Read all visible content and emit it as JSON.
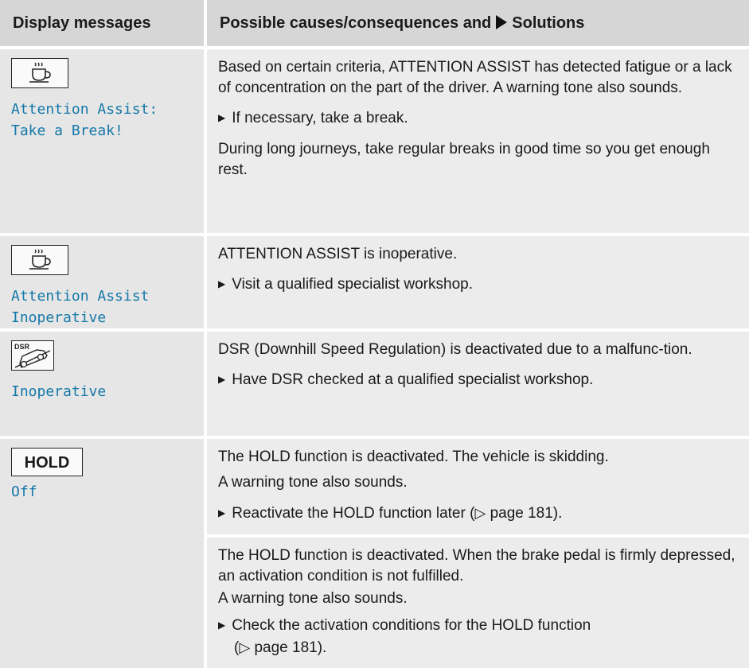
{
  "table": {
    "header_col1": "Display messages",
    "header_col2_pre": "Possible causes/consequences and",
    "header_col2_post": "Solutions"
  },
  "rows": [
    {
      "icon": "coffee-cup-icon",
      "message": "Attention Assist:\nTake a Break!",
      "text1": "Based on certain criteria, ATTENTION ASSIST has detected fatigue or a lack of concentration on the part of the driver. A warning tone also sounds.",
      "step1": "If necessary, take a break.",
      "text2": "During long journeys, take regular breaks in good time so you get enough rest."
    },
    {
      "icon": "coffee-cup-icon",
      "message": "Attention Assist\nInoperative",
      "text1": "ATTENTION ASSIST is inoperative.",
      "step1": "Visit a qualified specialist workshop."
    },
    {
      "icon": "dsr-icon",
      "icon_label": "DSR",
      "message": "Inoperative",
      "text1": "DSR (Downhill Speed Regulation) is deactivated due to a malfunc-tion.",
      "step1": "Have DSR checked at a qualified specialist workshop."
    },
    {
      "icon": "hold-icon",
      "icon_label": "HOLD",
      "message": "Off",
      "text1": "The HOLD function is deactivated. The vehicle is skidding.",
      "text2": "A warning tone also sounds.",
      "step1": "Reactivate the HOLD function later (",
      "step1_ref": "page 181).",
      "sub_text1": "The HOLD function is deactivated. When the brake pedal is firmly depressed, an activation condition is not fulfilled.",
      "sub_text2": "A warning tone also sounds.",
      "sub_step1": "Check the activation conditions for the HOLD function",
      "sub_step1_ref": "page 181)."
    }
  ]
}
